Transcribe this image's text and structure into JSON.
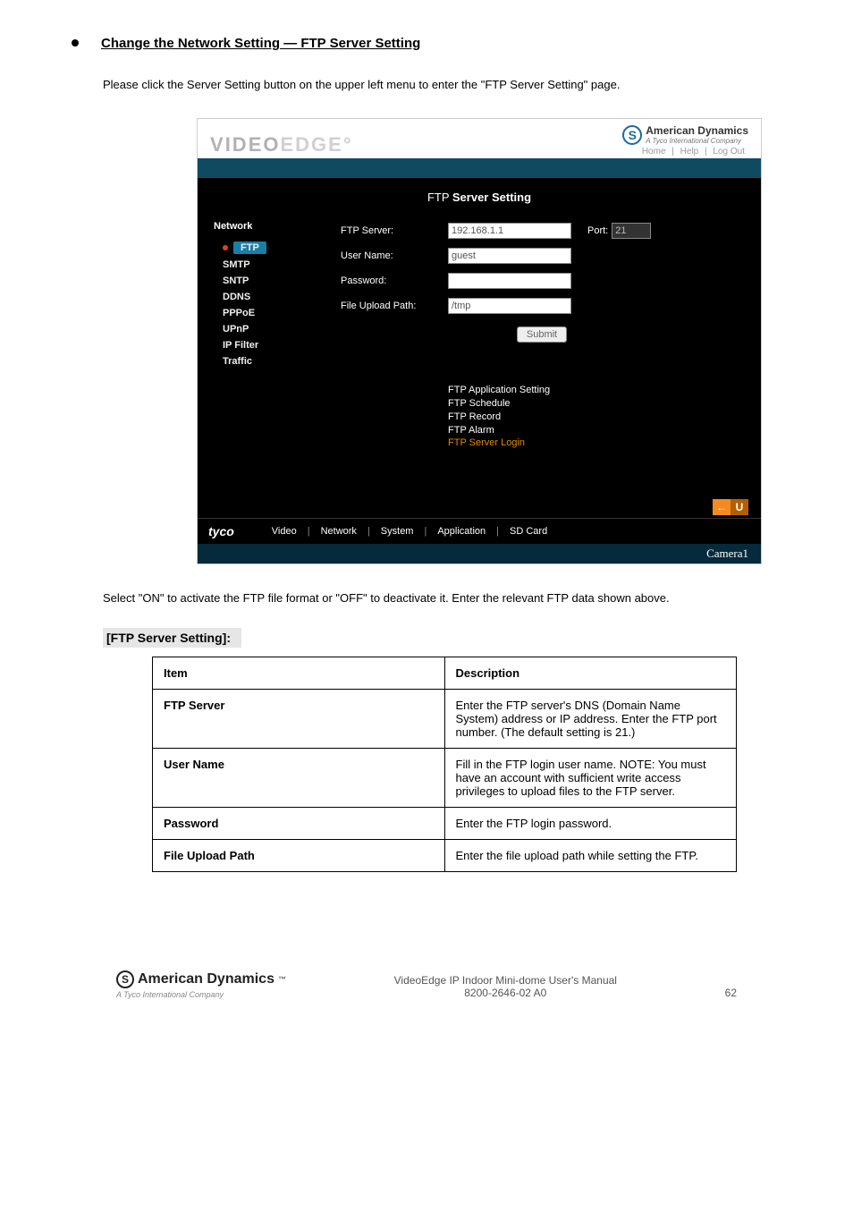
{
  "page": {
    "heading": "Change the Network Setting — FTP Server Setting",
    "intro": "Please click the Server Setting button on the upper left menu to enter the \"FTP Server Setting\" page.",
    "after_screenshot": "Select \"ON\" to activate the FTP file format or \"OFF\" to deactivate it. Enter the relevant FTP data shown above.",
    "section_heading": "[FTP Server Setting]:"
  },
  "screenshot": {
    "logo_left": "VIDEOEDGE",
    "brand_name": "American Dynamics",
    "brand_sub": "A Tyco International Company",
    "top_links": {
      "home": "Home",
      "help": "Help",
      "logout": "Log Out"
    },
    "title_plain": "FTP ",
    "title_bold": "Server Setting",
    "sidebar": {
      "group": "Network",
      "items": [
        "FTP",
        "SMTP",
        "SNTP",
        "DDNS",
        "PPPoE",
        "UPnP",
        "IP Filter",
        "Traffic"
      ]
    },
    "form": {
      "ftp_server_label": "FTP Server:",
      "ftp_server_value": "192.168.1.1",
      "port_label": "Port:",
      "port_value": "21",
      "user_label": "User Name:",
      "user_value": "guest",
      "pass_label": "Password:",
      "pass_value": "",
      "path_label": "File Upload Path:",
      "path_value": "/tmp",
      "submit": "Submit"
    },
    "links": {
      "l1": "FTP Application Setting",
      "l2": "FTP Schedule",
      "l3": "FTP Record",
      "l4": "FTP Alarm",
      "l5": "FTP Server Login"
    },
    "footer": {
      "tyco": "tyco",
      "nav": [
        "Video",
        "Network",
        "System",
        "Application",
        "SD Card"
      ],
      "arrow_left": "←",
      "arrow_u": "U",
      "camera": "Camera1"
    }
  },
  "table": {
    "header_item": "Item",
    "header_desc": "Description",
    "rows": [
      {
        "k": "FTP Server",
        "v": "Enter the FTP server's DNS (Domain Name System) address or IP address. Enter the FTP port number. (The default setting is 21.)"
      },
      {
        "k": "User Name",
        "v": "Fill in the FTP login user name. NOTE: You must have an account with sufficient write access privileges to upload files to the FTP server."
      },
      {
        "k": "Password",
        "v": "Enter the FTP login password."
      },
      {
        "k": "File Upload Path",
        "v": "Enter the file upload path while setting the FTP."
      }
    ]
  },
  "footer": {
    "brand": "American Dynamics",
    "sub": "A Tyco International Company",
    "center_line1": "VideoEdge IP Indoor Mini-dome User's Manual",
    "center_line2": "8200-2646-02 A0",
    "page": "62"
  }
}
